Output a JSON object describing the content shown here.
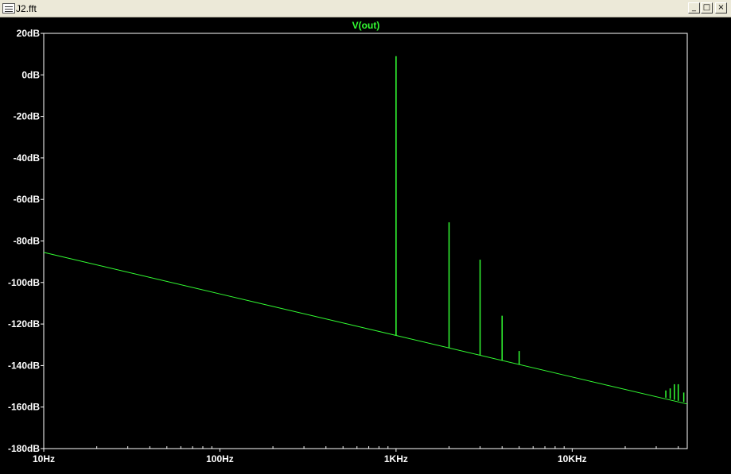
{
  "window": {
    "title": "J2.fft",
    "minimize_glyph": "_",
    "maximize_glyph": "□",
    "close_glyph": "×"
  },
  "colors": {
    "background": "#000000",
    "frame": "#ffffff",
    "trace": "#33ff33"
  },
  "chart_data": {
    "type": "line",
    "series": [
      {
        "name": "V(out)",
        "noise_floor": [
          [
            10,
            -85.5
          ],
          [
            100,
            -105.5
          ],
          [
            1000,
            -125.5
          ],
          [
            10000,
            -145.5
          ],
          [
            40000,
            -157.5
          ],
          [
            45000,
            -158.5
          ]
        ],
        "spikes": [
          {
            "x": 1000,
            "from": -125.5,
            "y": 9
          },
          {
            "x": 2000,
            "from": -131.5,
            "y": -71
          },
          {
            "x": 3000,
            "from": -135,
            "y": -89
          },
          {
            "x": 4000,
            "from": -137.5,
            "y": -116
          },
          {
            "x": 5000,
            "from": -139.5,
            "y": -133
          },
          {
            "x": 34000,
            "from": -155.5,
            "y": -152
          },
          {
            "x": 36000,
            "from": -156,
            "y": -151
          },
          {
            "x": 38000,
            "from": -156.5,
            "y": -149
          },
          {
            "x": 40000,
            "from": -157,
            "y": -149
          },
          {
            "x": 43000,
            "from": -157.5,
            "y": -153
          }
        ]
      }
    ],
    "xscale": "log",
    "xlim": [
      10,
      45000
    ],
    "ylim": [
      -180,
      20
    ],
    "x_ticks": [
      {
        "value": 10,
        "label": "10Hz"
      },
      {
        "value": 100,
        "label": "100Hz"
      },
      {
        "value": 1000,
        "label": "1KHz"
      },
      {
        "value": 10000,
        "label": "10KHz"
      }
    ],
    "y_ticks": [
      {
        "value": 20,
        "label": "20dB"
      },
      {
        "value": 0,
        "label": "0dB"
      },
      {
        "value": -20,
        "label": "-20dB"
      },
      {
        "value": -40,
        "label": "-40dB"
      },
      {
        "value": -60,
        "label": "-60dB"
      },
      {
        "value": -80,
        "label": "-80dB"
      },
      {
        "value": -100,
        "label": "-100dB"
      },
      {
        "value": -120,
        "label": "-120dB"
      },
      {
        "value": -140,
        "label": "-140dB"
      },
      {
        "value": -160,
        "label": "-160dB"
      },
      {
        "value": -180,
        "label": "-180dB"
      }
    ],
    "grid": false
  }
}
